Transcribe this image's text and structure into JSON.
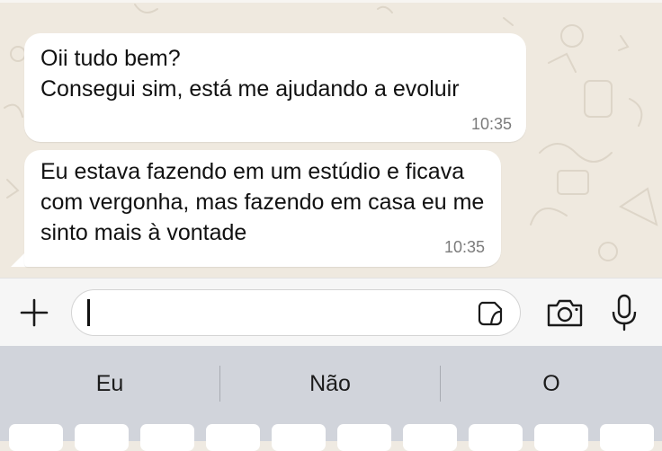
{
  "messages": [
    {
      "text": "Oii tudo bem?\nConsegui sim, está me ajudando a evoluir",
      "time": "10:35"
    },
    {
      "text": "Eu estava fazendo em um estúdio e ficava com vergonha, mas fazendo em casa eu me sinto mais à vontade",
      "time": "10:35"
    }
  ],
  "input": {
    "value": "",
    "icons": [
      "plus-icon",
      "sticker-icon",
      "camera-icon",
      "microphone-icon"
    ]
  },
  "keyboard": {
    "suggestions": [
      "Eu",
      "Não",
      "O"
    ]
  },
  "colors": {
    "chat_background": "#efe9df",
    "bubble": "#ffffff",
    "timestamp": "#7b7b7b",
    "keyboard": "#d1d4db",
    "input_bar": "#f6f6f6"
  }
}
